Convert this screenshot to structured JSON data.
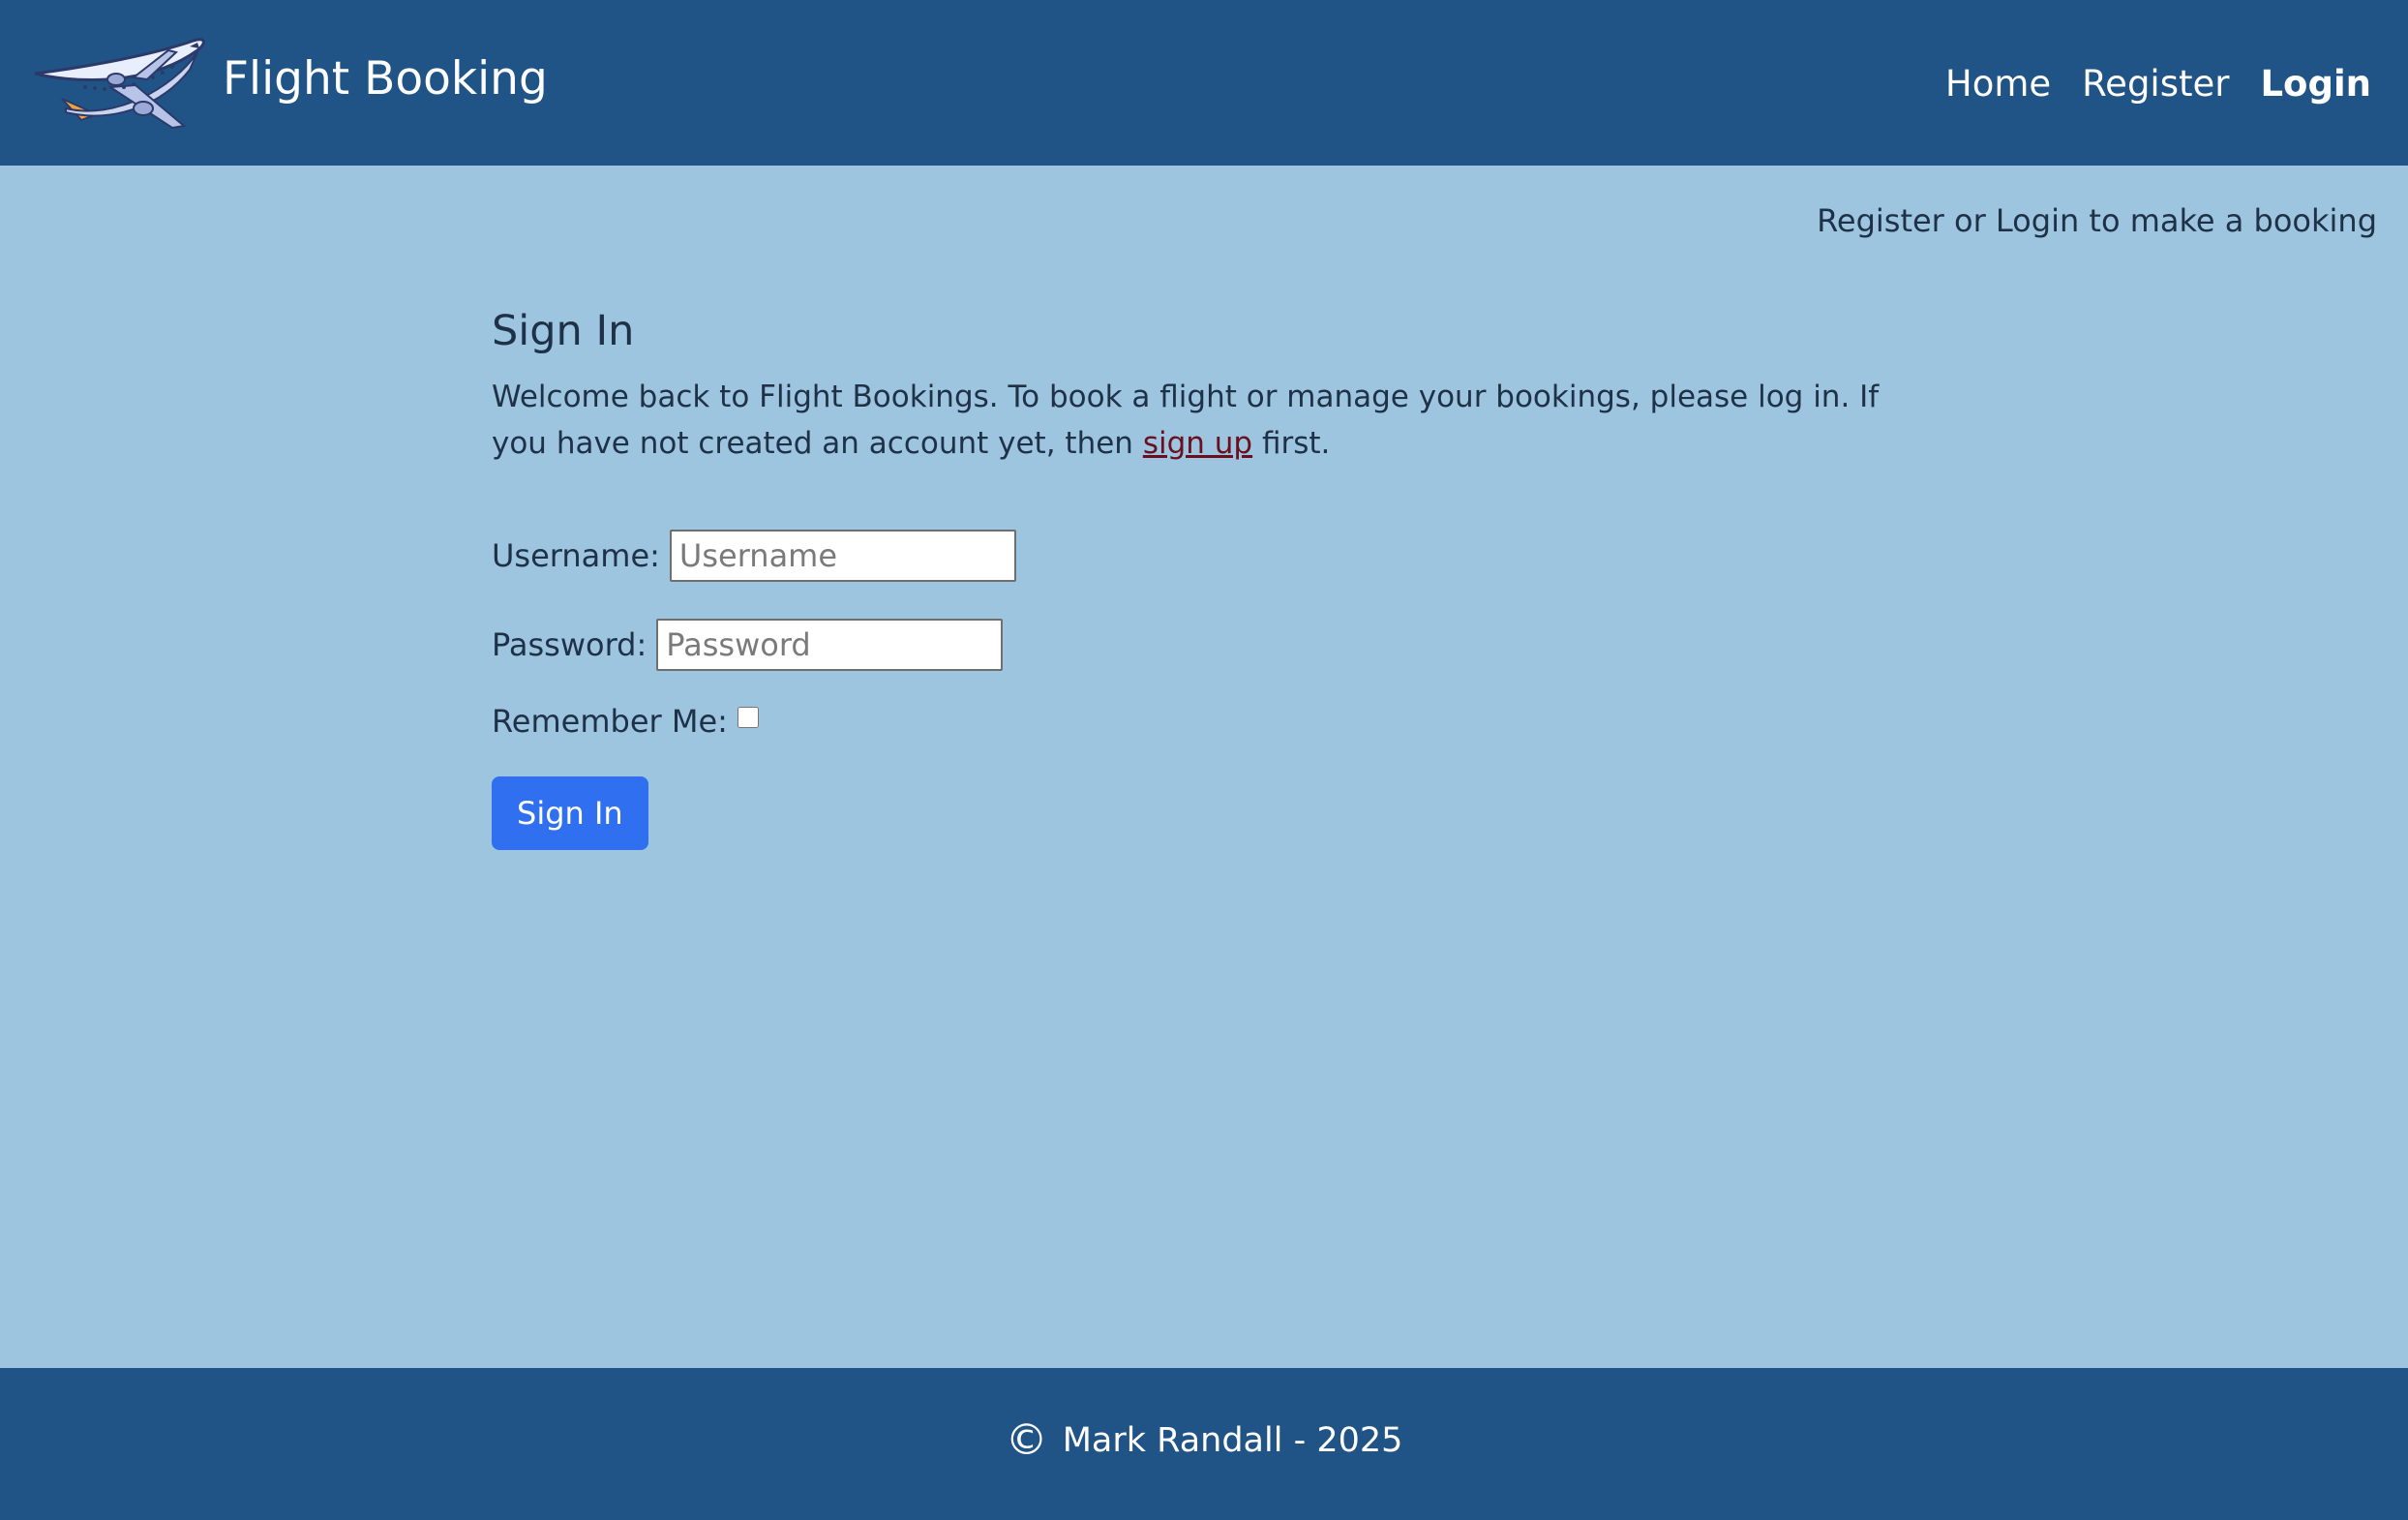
{
  "header": {
    "brand": "Flight Booking",
    "logo_icon": "airplane-icon",
    "nav": [
      {
        "label": "Home",
        "active": false
      },
      {
        "label": "Register",
        "active": false
      },
      {
        "label": "Login",
        "active": true
      }
    ]
  },
  "status": {
    "message": "Register or Login to make a booking"
  },
  "signin": {
    "title": "Sign In",
    "intro_before": "Welcome back to Flight Bookings. To book a flight or manage your bookings, please log in. If you have not created an account yet, then",
    "intro_link": "sign up",
    "intro_after": "first.",
    "username_label": "Username:",
    "username_placeholder": "Username",
    "username_value": "",
    "password_label": "Password:",
    "password_placeholder": "Password",
    "password_value": "",
    "remember_label": "Remember Me:",
    "remember_checked": false,
    "submit_label": "Sign In"
  },
  "footer": {
    "copyright_symbol": "©",
    "text": "Mark Randall - 2025"
  },
  "colors": {
    "navbar": "#205386",
    "page_background": "#9dc5e0",
    "text": "#1e3147",
    "link": "#6b0f1e",
    "button": "#2f6ff0"
  }
}
